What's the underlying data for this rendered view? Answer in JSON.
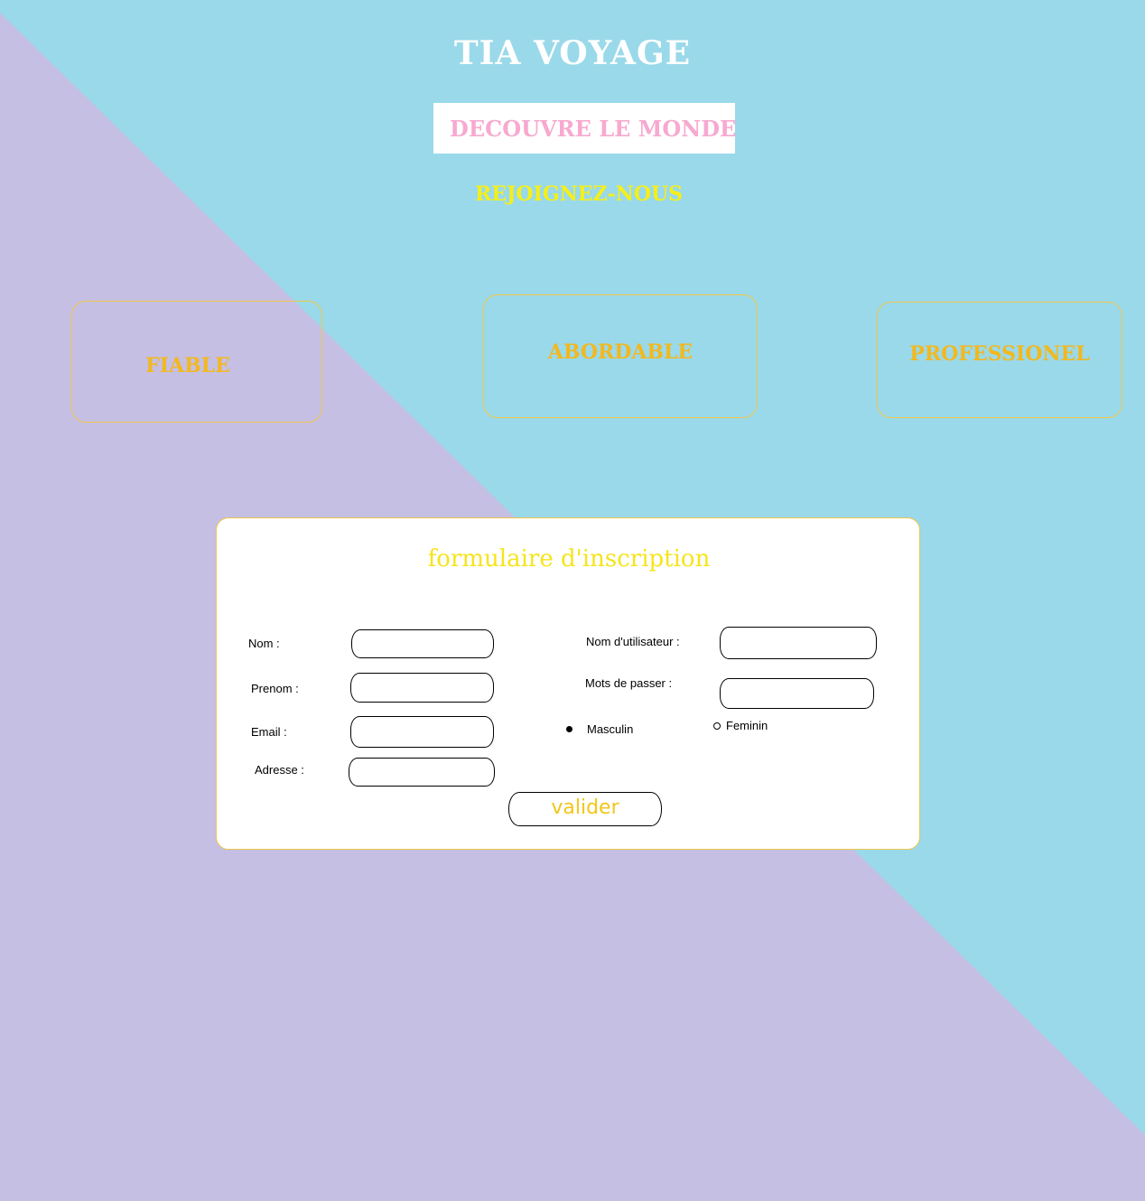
{
  "colors": {
    "background_blue": "#9ad9e9",
    "background_lavender": "#c5bfe4",
    "title": "#ffffff",
    "tagline": "#f7a9cf",
    "join": "#f5ef1a",
    "card_text": "#f2b81f",
    "card_border": "#f0c64a",
    "form_title": "#f5e51b",
    "submit_text": "#f2c619"
  },
  "header": {
    "title": "TIA VOYAGE",
    "tagline": "DECOUVRE LE MONDE",
    "join_label": "REJOIGNEZ-NOUS"
  },
  "features": [
    {
      "label": "FIABLE"
    },
    {
      "label": "ABORDABLE"
    },
    {
      "label": "PROFESSIONEL"
    }
  ],
  "form": {
    "title": "formulaire d'inscription",
    "fields": {
      "nom": {
        "label": "Nom :",
        "value": ""
      },
      "prenom": {
        "label": "Prenom :",
        "value": ""
      },
      "email": {
        "label": "Email :",
        "value": ""
      },
      "adresse": {
        "label": "Adresse :",
        "value": ""
      },
      "username": {
        "label": "Nom d'utilisateur :",
        "value": ""
      },
      "password": {
        "label": "Mots de passer :",
        "value": ""
      }
    },
    "gender": {
      "options": [
        "Masculin",
        "Feminin"
      ],
      "selected": "Masculin"
    },
    "submit_label": "valider"
  }
}
